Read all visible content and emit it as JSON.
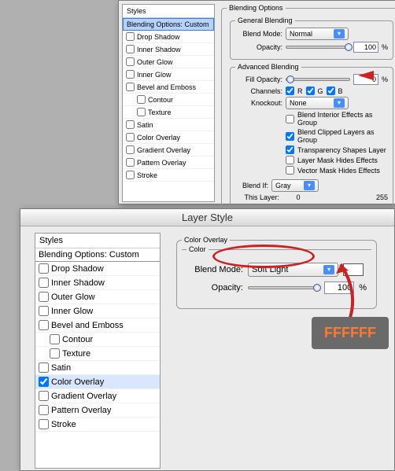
{
  "back": {
    "styles_title": "Styles",
    "blending_header": "Blending Options: Custom",
    "items": [
      "Drop Shadow",
      "Inner Shadow",
      "Outer Glow",
      "Inner Glow",
      "Bevel and Emboss",
      "Contour",
      "Texture",
      "Satin",
      "Color Overlay",
      "Gradient Overlay",
      "Pattern Overlay",
      "Stroke"
    ],
    "blending_options_title": "Blending Options",
    "general_title": "General Blending",
    "blend_mode_label": "Blend Mode:",
    "blend_mode_value": "Normal",
    "opacity_label": "Opacity:",
    "opacity_value": "100",
    "percent": "%",
    "advanced_title": "Advanced Blending",
    "fill_opacity_label": "Fill Opacity:",
    "fill_opacity_value": "0",
    "channels_label": "Channels:",
    "ch_r": "R",
    "ch_g": "G",
    "ch_b": "B",
    "knockout_label": "Knockout:",
    "knockout_value": "None",
    "cb1": "Blend Interior Effects as Group",
    "cb2": "Blend Clipped Layers as Group",
    "cb3": "Transparency Shapes Layer",
    "cb4": "Layer Mask Hides Effects",
    "cb5": "Vector Mask Hides Effects",
    "blend_if_label": "Blend If:",
    "blend_if_value": "Gray",
    "this_layer_label": "This Layer:",
    "this_layer_min": "0",
    "this_layer_max": "255"
  },
  "front": {
    "window_title": "Layer Style",
    "styles_title": "Styles",
    "blending_header": "Blending Options: Custom",
    "items": [
      "Drop Shadow",
      "Inner Shadow",
      "Outer Glow",
      "Inner Glow",
      "Bevel and Emboss",
      "Contour",
      "Texture",
      "Satin",
      "Color Overlay",
      "Gradient Overlay",
      "Pattern Overlay",
      "Stroke"
    ],
    "checked_index": 8,
    "group_title": "Color Overlay",
    "inner_title": "Color",
    "blend_mode_label": "Blend Mode:",
    "blend_mode_value": "Soft Light",
    "swatch_color": "#ffffff",
    "opacity_label": "Opacity:",
    "opacity_value": "100",
    "percent": "%"
  },
  "annotation_text": "FFFFFF"
}
